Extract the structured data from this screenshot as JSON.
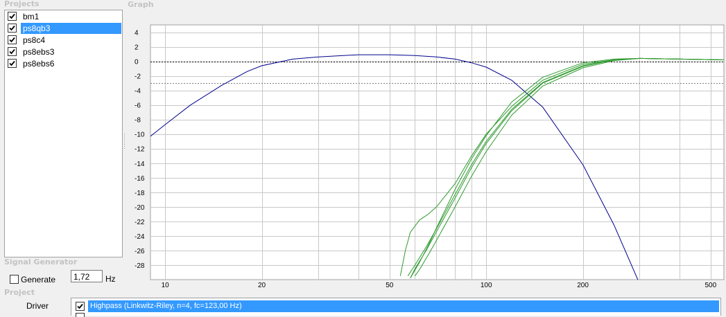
{
  "sections": {
    "projects": "Projects",
    "graph": "Graph",
    "signal_generator": "Signal Generator",
    "project": "Project"
  },
  "projects": [
    {
      "label": "bm1",
      "checked": true,
      "selected": false
    },
    {
      "label": "ps8qb3",
      "checked": true,
      "selected": true
    },
    {
      "label": "ps8c4",
      "checked": true,
      "selected": false
    },
    {
      "label": "ps8ebs3",
      "checked": true,
      "selected": false
    },
    {
      "label": "ps8ebs6",
      "checked": true,
      "selected": false
    }
  ],
  "signal_generator": {
    "generate_label": "Generate",
    "generate_checked": false,
    "frequency_value": "1,72",
    "unit": "Hz"
  },
  "project": {
    "driver_label": "Driver",
    "filters": [
      {
        "label": "Highpass (Linkwitz-Riley, n=4, fc=123,00 Hz)",
        "checked": true,
        "selected": true
      }
    ]
  },
  "chart_data": {
    "type": "line",
    "x_scale": "log",
    "xlim": [
      9,
      550
    ],
    "ylim": [
      -30,
      5
    ],
    "x_tick_labels": [
      "10",
      "20",
      "50",
      "100",
      "200",
      "500"
    ],
    "y_tick_labels": [
      "4",
      "2",
      "0",
      "-2",
      "-4",
      "-6",
      "-8",
      "-10",
      "-12",
      "-14",
      "-16",
      "-18",
      "-20",
      "-22",
      "-24",
      "-26",
      "-28"
    ],
    "grid": true,
    "reference_lines": [
      {
        "y": 0,
        "style": "dotted",
        "color": "#000000"
      },
      {
        "y": -3,
        "style": "dotted",
        "color": "#808080"
      }
    ],
    "colors": {
      "lowpass": "#00008b",
      "highpass": "#2e9a2e"
    },
    "series": [
      {
        "group": "lowpass",
        "x": [
          9,
          10,
          12,
          15,
          18,
          20,
          25,
          30,
          40,
          50,
          60,
          70,
          80,
          90,
          100,
          120,
          150,
          200,
          250,
          300
        ],
        "y": [
          -10.3,
          -8.7,
          -6.0,
          -3.3,
          -1.4,
          -0.6,
          0.3,
          0.6,
          0.9,
          0.9,
          0.8,
          0.6,
          0.3,
          -0.2,
          -0.8,
          -2.6,
          -6.3,
          -14.2,
          -22.5,
          -30.5
        ]
      },
      {
        "group": "highpass",
        "x": [
          54,
          56,
          58,
          62,
          66,
          70,
          80,
          90,
          100,
          120,
          150,
          200,
          250,
          300,
          400,
          550
        ],
        "y": [
          -29.5,
          -26,
          -23.5,
          -21.8,
          -21.0,
          -20.0,
          -16.8,
          -13.0,
          -10.0,
          -6.2,
          -2.6,
          -0.4,
          0.2,
          0.4,
          0.3,
          0.2
        ]
      },
      {
        "group": "highpass",
        "x": [
          57,
          60,
          65,
          70,
          80,
          90,
          100,
          120,
          150,
          200,
          250,
          300,
          400,
          550
        ],
        "y": [
          -29.5,
          -28.0,
          -25.5,
          -23.0,
          -18.3,
          -14.2,
          -11.0,
          -6.6,
          -2.9,
          -0.6,
          0.2,
          0.4,
          0.3,
          0.2
        ]
      },
      {
        "group": "highpass",
        "x": [
          58,
          60,
          65,
          70,
          80,
          90,
          100,
          120,
          150,
          200,
          250,
          300,
          400,
          550
        ],
        "y": [
          -29.8,
          -28.5,
          -26.0,
          -23.4,
          -18.8,
          -14.6,
          -11.3,
          -6.8,
          -3.0,
          -0.7,
          0.2,
          0.4,
          0.3,
          0.2
        ]
      },
      {
        "group": "highpass",
        "x": [
          60,
          62,
          66,
          70,
          80,
          90,
          100,
          120,
          150,
          200,
          250,
          300,
          400,
          550
        ],
        "y": [
          -29.5,
          -28.6,
          -26.6,
          -24.6,
          -20.0,
          -15.8,
          -12.4,
          -7.4,
          -3.4,
          -0.9,
          0.1,
          0.4,
          0.3,
          0.2
        ]
      },
      {
        "group": "highpass",
        "x": [
          58,
          62,
          66,
          70,
          80,
          90,
          100,
          120,
          150,
          200,
          250,
          300,
          400,
          550
        ],
        "y": [
          -29.8,
          -27.6,
          -25.3,
          -22.9,
          -17.6,
          -13.4,
          -10.2,
          -5.6,
          -2.2,
          -0.2,
          0.3,
          0.4,
          0.3,
          0.2
        ]
      }
    ]
  }
}
